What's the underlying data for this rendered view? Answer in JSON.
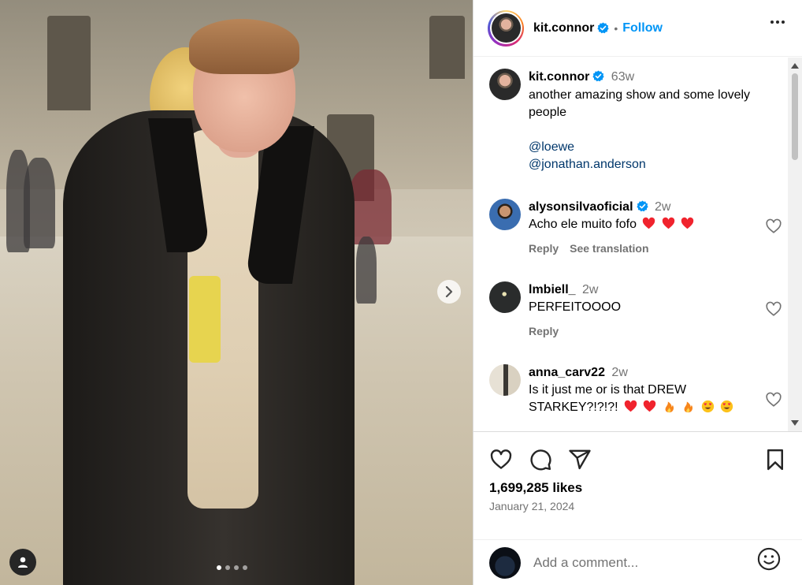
{
  "post": {
    "username": "kit.connor",
    "follow_label": "Follow",
    "separator": "•",
    "caption": {
      "username": "kit.connor",
      "time": "63w",
      "text": "another amazing show and some lovely people",
      "mentions": [
        "@loewe",
        "@jonathan.anderson"
      ]
    },
    "likes": "1,699,285 likes",
    "date": "January 21, 2024",
    "carousel": {
      "slides": 4,
      "active": 1
    }
  },
  "comments": [
    {
      "username": "alysonsilvaoficial",
      "verified": true,
      "time": "2w",
      "text": "Acho ele muito fofo",
      "emojis": [
        "red-heart",
        "red-heart",
        "red-heart"
      ],
      "reply_label": "Reply",
      "translate_label": "See translation"
    },
    {
      "username": "lmbiell_",
      "verified": false,
      "time": "2w",
      "text": "PERFEITOOOO",
      "reply_label": "Reply"
    },
    {
      "username": "anna_carv22",
      "verified": false,
      "time": "2w",
      "text": "Is it just me or is that DREW STARKEY?!?!?!",
      "emojis": [
        "red-heart",
        "red-heart",
        "fire",
        "fire",
        "heart-eyes",
        "heart-eyes"
      ]
    }
  ],
  "add_comment": {
    "placeholder": "Add a comment..."
  },
  "colors": {
    "accent": "#0095f6",
    "verified": "#0095f6",
    "muted": "#737373",
    "mention": "#00376b",
    "heart": "#ff3040"
  }
}
